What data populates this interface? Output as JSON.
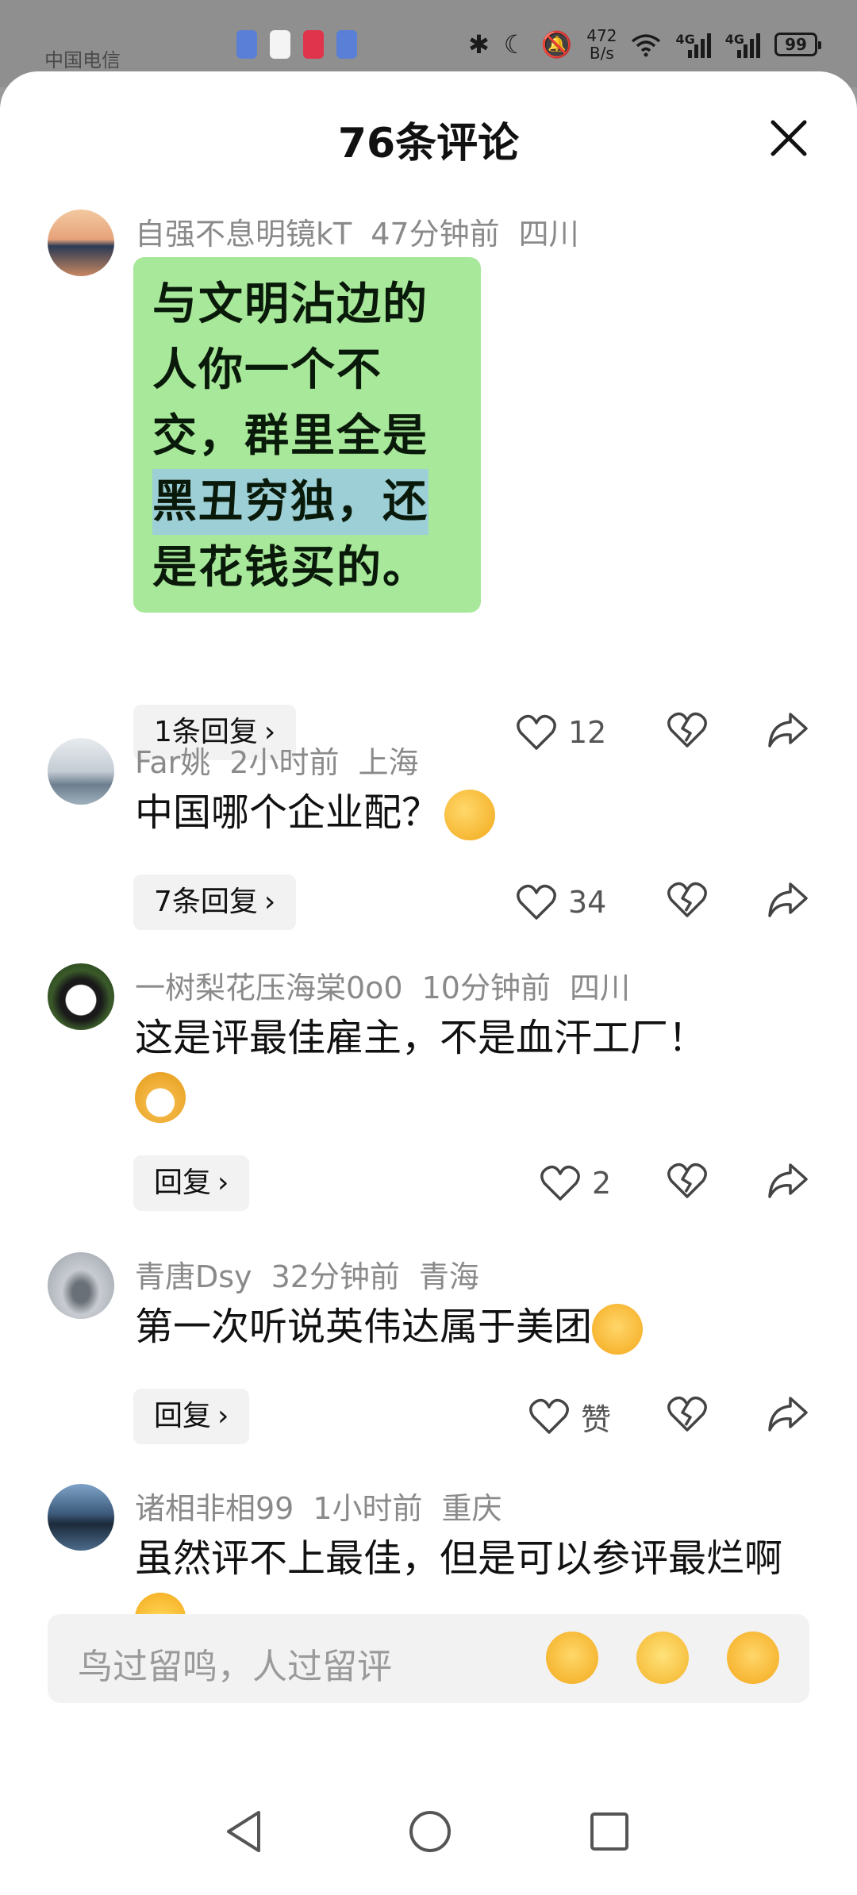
{
  "status": {
    "carrier": "中国电信",
    "speed_value": "472",
    "speed_unit": "B/s",
    "net1": "4G",
    "net2": "4G",
    "battery": "99"
  },
  "sheet": {
    "title": "76条评论"
  },
  "comments": [
    {
      "user": "自强不息明镜kT",
      "time": "47分钟前",
      "location": "四川",
      "image_text": [
        "与文明沾边的",
        "人你一个不",
        "交，群里全是",
        "黑丑穷独，还",
        "是花钱买的。"
      ],
      "reply": "1条回复",
      "likes": "12"
    },
    {
      "user": "Far姚",
      "time": "2小时前",
      "location": "上海",
      "text": "中国哪个企业配？",
      "reply": "7条回复",
      "likes": "34"
    },
    {
      "user": "一树梨花压海棠0o0",
      "time": "10分钟前",
      "location": "四川",
      "text": "这是评最佳雇主，不是血汗工厂！",
      "reply": "回复",
      "likes": "2"
    },
    {
      "user": "青唐Dsy",
      "time": "32分钟前",
      "location": "青海",
      "text": "第一次听说英伟达属于美团",
      "reply": "回复",
      "likes": "赞"
    },
    {
      "user": "诸相非相99",
      "time": "1小时前",
      "location": "重庆",
      "text": "虽然评不上最佳，但是可以参评最烂啊"
    }
  ],
  "input": {
    "placeholder": "鸟过留鸣，人过留评"
  },
  "icons": {
    "close": "close-icon",
    "like": "heart-outline-icon",
    "dislike": "broken-heart-icon",
    "share": "share-arrow-icon",
    "chevron": "chevron-right-icon",
    "nav": [
      "back-triangle-icon",
      "home-circle-icon",
      "recents-square-icon"
    ]
  }
}
